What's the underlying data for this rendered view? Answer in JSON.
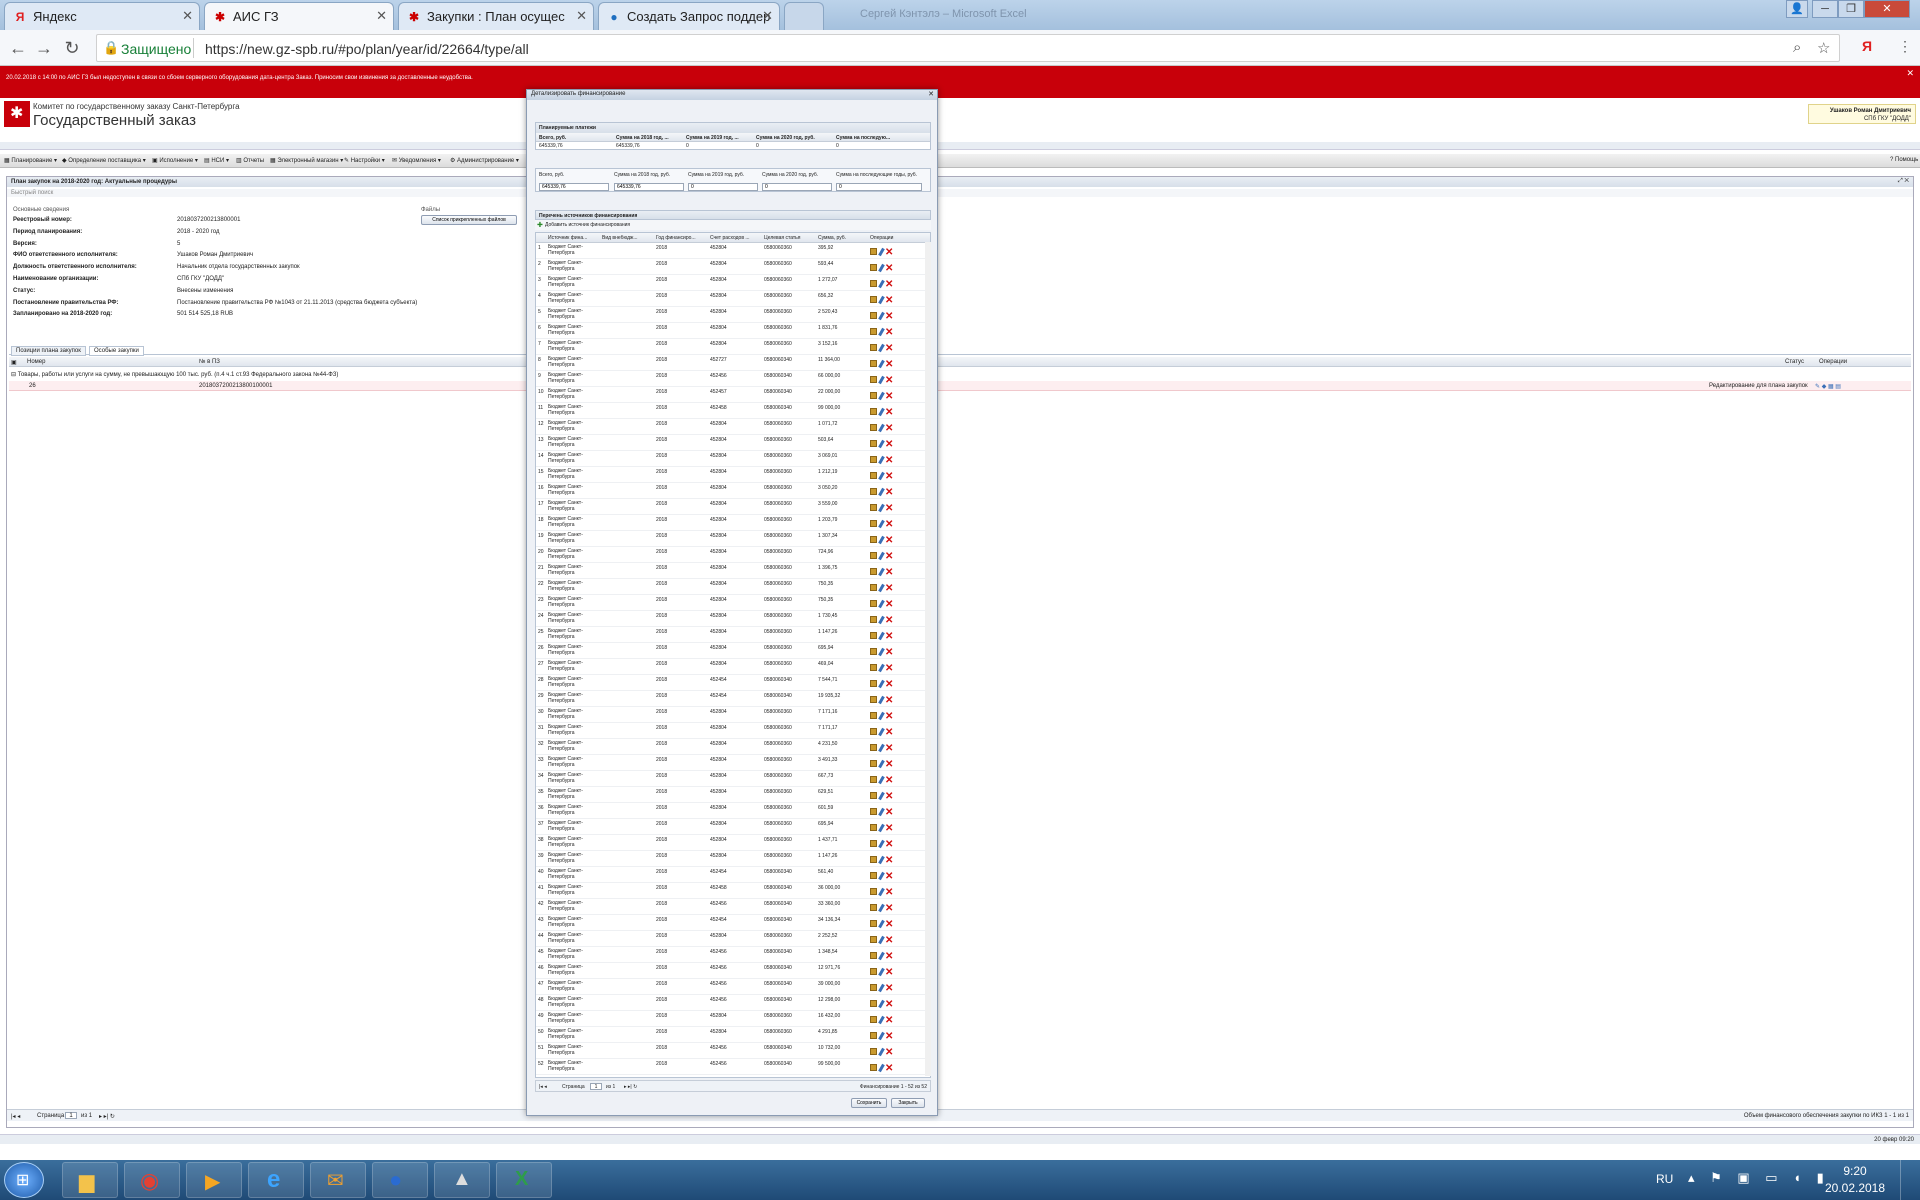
{
  "browser": {
    "tabs": [
      {
        "title": "Яндекс",
        "icon": "yandex-icon"
      },
      {
        "title": "АИС ГЗ",
        "icon": "gz-icon"
      },
      {
        "title": "Закупки : План осущес",
        "icon": "gz-icon"
      },
      {
        "title": "Создать Запрос поддер",
        "icon": "globe-icon"
      },
      {
        "title": "",
        "icon": "blank-icon"
      }
    ],
    "secure_label": "Защищено",
    "url": "https://new.gz-spb.ru/#po/plan/year/id/22664/type/all",
    "window_title": "Сергей Кэнтэлэ – Microsoft Excel"
  },
  "banner": {
    "text": "20.02.2018 с 14:00 по АИС ГЗ был недоступен в связи со сбоем серверного оборудования дата-центра Заказ. Приносим свои извинения за доставленные неудобства."
  },
  "app": {
    "org_line": "Комитет по государственному заказу Санкт-Петербурга",
    "brand": "Государственный заказ",
    "user_name": "Ушаков Роман Дмитриевич",
    "user_org": "СПб ГКУ \"ДОДД\"",
    "menu": [
      "Планирование",
      "Определение поставщика",
      "Исполнение",
      "НСИ",
      "Отчеты",
      "Электронный магазин",
      "Настройки",
      "Уведомления",
      "Администрирование"
    ],
    "help": "Помощь"
  },
  "plan": {
    "title": "План закупок на 2018-2020 год: Актуальные процедуры",
    "quick_search": "Быстрый поиск",
    "section": "Основные сведения",
    "files_label": "Файлы",
    "files_button": "Список прикрепленных файлов",
    "fields": [
      {
        "label": "Реестровый номер:",
        "value": "2018037200213800001"
      },
      {
        "label": "Период планирования:",
        "value": "2018 - 2020 год"
      },
      {
        "label": "Версия:",
        "value": "5"
      },
      {
        "label": "ФИО ответственного исполнителя:",
        "value": "Ушаков Роман Дмитриевич"
      },
      {
        "label": "Должность ответственного исполнителя:",
        "value": "Начальник отдела государственных закупок"
      },
      {
        "label": "Наименование организации:",
        "value": "СПб ГКУ \"ДОДД\""
      },
      {
        "label": "Статус:",
        "value": "Внесены изменения"
      },
      {
        "label": "Постановление правительства РФ:",
        "value": "Постановление правительства РФ №1043 от 21.11.2013 (средства бюджета субъекта)"
      },
      {
        "label": "Запланировано на 2018-2020 год:",
        "value": "501 514 525,18 RUB"
      }
    ],
    "tabs": [
      "Позиции плана закупок",
      "Особые закупки"
    ],
    "grid_headers": [
      "Номер",
      "№ в ПЗ",
      "Статус",
      "Операции"
    ],
    "group_row": "Товары, работы или услуги на сумму, не превышающую 100 тыс. руб. (п.4 ч.1 ст.93 Федерального закона №44-ФЗ)",
    "row": {
      "num": "26",
      "pz": "2018037200213800100001",
      "status": "Редактирование для плана закупок"
    },
    "pager": {
      "page_label": "Страница",
      "page": "1",
      "of": "из 1"
    },
    "footer_text": "Объем финансового обеспечения закупки по ИКЗ 1 - 1 из 1"
  },
  "modal": {
    "title": "Детализировать финансирование",
    "planned_section": "Планируемые платежи",
    "planned_headers": [
      "Всего, руб.",
      "Сумма на 2018 год, ...",
      "Сумма на 2019 год, ...",
      "Сумма на 2020 год, руб.",
      "Сумма на последую..."
    ],
    "planned_values": [
      "645339,76",
      "645339,76",
      "0",
      "0",
      "0"
    ],
    "edit_headers": [
      "Всего, руб.",
      "Сумма на 2018 год, руб.",
      "Сумма на 2019 год, руб.",
      "Сумма на 2020 год, руб.",
      "Сумма на последующие годы, руб."
    ],
    "edit_values": [
      "645339,76",
      "645339,76",
      "0",
      "0",
      "0"
    ],
    "sources_section": "Перечень источников финансирования",
    "add_button": "Добавить источник финансирования",
    "grid_headers": [
      "Источник фина...",
      "Вид внебюдж...",
      "Год финансиро...",
      "Счет расходов ...",
      "Целевая статья",
      "Сумма, руб.",
      "Операции"
    ],
    "source_name": "Бюджет Санкт-Петербурга",
    "year": "2018",
    "rows": [
      {
        "n": "1",
        "acc": "452804",
        "cs": "0580060360",
        "sum": "395,92"
      },
      {
        "n": "2",
        "acc": "452804",
        "cs": "0580060360",
        "sum": "593,44"
      },
      {
        "n": "3",
        "acc": "452804",
        "cs": "0580060360",
        "sum": "1 272,07"
      },
      {
        "n": "4",
        "acc": "452804",
        "cs": "0580060360",
        "sum": "656,32"
      },
      {
        "n": "5",
        "acc": "452804",
        "cs": "0580060360",
        "sum": "2 520,43"
      },
      {
        "n": "6",
        "acc": "452804",
        "cs": "0580060360",
        "sum": "1 831,76"
      },
      {
        "n": "7",
        "acc": "452804",
        "cs": "0580060360",
        "sum": "3 152,16"
      },
      {
        "n": "8",
        "acc": "452727",
        "cs": "0580060340",
        "sum": "11 364,00"
      },
      {
        "n": "9",
        "acc": "452456",
        "cs": "0580060340",
        "sum": "66 000,00"
      },
      {
        "n": "10",
        "acc": "452457",
        "cs": "0580060340",
        "sum": "22 000,00"
      },
      {
        "n": "11",
        "acc": "452458",
        "cs": "0580060340",
        "sum": "99 000,00"
      },
      {
        "n": "12",
        "acc": "452804",
        "cs": "0580060360",
        "sum": "1 071,72"
      },
      {
        "n": "13",
        "acc": "452804",
        "cs": "0580060360",
        "sum": "503,64"
      },
      {
        "n": "14",
        "acc": "452804",
        "cs": "0580060360",
        "sum": "3 069,01"
      },
      {
        "n": "15",
        "acc": "452804",
        "cs": "0580060360",
        "sum": "1 212,19"
      },
      {
        "n": "16",
        "acc": "452804",
        "cs": "0580060360",
        "sum": "3 050,20"
      },
      {
        "n": "17",
        "acc": "452804",
        "cs": "0580060360",
        "sum": "3 559,00"
      },
      {
        "n": "18",
        "acc": "452804",
        "cs": "0580060360",
        "sum": "1 203,79"
      },
      {
        "n": "19",
        "acc": "452804",
        "cs": "0580060360",
        "sum": "1 307,34"
      },
      {
        "n": "20",
        "acc": "452804",
        "cs": "0580060360",
        "sum": "724,96"
      },
      {
        "n": "21",
        "acc": "452804",
        "cs": "0580060360",
        "sum": "1 396,75"
      },
      {
        "n": "22",
        "acc": "452804",
        "cs": "0580060360",
        "sum": "750,35"
      },
      {
        "n": "23",
        "acc": "452804",
        "cs": "0580060360",
        "sum": "750,35"
      },
      {
        "n": "24",
        "acc": "452804",
        "cs": "0580060360",
        "sum": "1 730,45"
      },
      {
        "n": "25",
        "acc": "452804",
        "cs": "0580060360",
        "sum": "1 147,26"
      },
      {
        "n": "26",
        "acc": "452804",
        "cs": "0580060360",
        "sum": "695,94"
      },
      {
        "n": "27",
        "acc": "452804",
        "cs": "0580060360",
        "sum": "469,04"
      },
      {
        "n": "28",
        "acc": "452454",
        "cs": "0580060340",
        "sum": "7 544,71"
      },
      {
        "n": "29",
        "acc": "452454",
        "cs": "0580060340",
        "sum": "19 935,32"
      },
      {
        "n": "30",
        "acc": "452804",
        "cs": "0580060360",
        "sum": "7 171,16"
      },
      {
        "n": "31",
        "acc": "452804",
        "cs": "0580060360",
        "sum": "7 171,17"
      },
      {
        "n": "32",
        "acc": "452804",
        "cs": "0580060360",
        "sum": "4 231,50"
      },
      {
        "n": "33",
        "acc": "452804",
        "cs": "0580060360",
        "sum": "3 491,33"
      },
      {
        "n": "34",
        "acc": "452804",
        "cs": "0580060360",
        "sum": "667,73"
      },
      {
        "n": "35",
        "acc": "452804",
        "cs": "0580060360",
        "sum": "629,51"
      },
      {
        "n": "36",
        "acc": "452804",
        "cs": "0580060360",
        "sum": "601,59"
      },
      {
        "n": "37",
        "acc": "452804",
        "cs": "0580060360",
        "sum": "695,94"
      },
      {
        "n": "38",
        "acc": "452804",
        "cs": "0580060360",
        "sum": "1 437,71"
      },
      {
        "n": "39",
        "acc": "452804",
        "cs": "0580060360",
        "sum": "1 147,26"
      },
      {
        "n": "40",
        "acc": "452454",
        "cs": "0580060340",
        "sum": "561,40"
      },
      {
        "n": "41",
        "acc": "452458",
        "cs": "0580060340",
        "sum": "36 000,00"
      },
      {
        "n": "42",
        "acc": "452456",
        "cs": "0580060340",
        "sum": "33 360,00"
      },
      {
        "n": "43",
        "acc": "452454",
        "cs": "0580060340",
        "sum": "34 136,34"
      },
      {
        "n": "44",
        "acc": "452804",
        "cs": "0580060360",
        "sum": "2 252,52"
      },
      {
        "n": "45",
        "acc": "452456",
        "cs": "0580060340",
        "sum": "1 348,54"
      },
      {
        "n": "46",
        "acc": "452456",
        "cs": "0580060340",
        "sum": "12 971,76"
      },
      {
        "n": "47",
        "acc": "452456",
        "cs": "0580060340",
        "sum": "39 000,00"
      },
      {
        "n": "48",
        "acc": "452456",
        "cs": "0580060340",
        "sum": "12 298,00"
      },
      {
        "n": "49",
        "acc": "452804",
        "cs": "0580060360",
        "sum": "16 432,00"
      },
      {
        "n": "50",
        "acc": "452804",
        "cs": "0580060360",
        "sum": "4 291,85"
      },
      {
        "n": "51",
        "acc": "452456",
        "cs": "0580060340",
        "sum": "10 732,00"
      },
      {
        "n": "52",
        "acc": "452456",
        "cs": "0580060340",
        "sum": "99 500,00"
      }
    ],
    "pager": {
      "page_label": "Страница",
      "page": "1",
      "of": "из 1",
      "summary": "Финансирование 1 - 52 из 52"
    },
    "save": "Сохранить",
    "close": "Закрыть"
  },
  "taskbar": {
    "lang": "RU",
    "time": "9:20",
    "date": "20.02.2018",
    "status_right": "20 февр 09:20",
    "apps": [
      "files-icon",
      "chrome-icon",
      "media-icon",
      "ie-icon",
      "outlook-icon",
      "browser2-icon",
      "app-icon",
      "excel-icon"
    ]
  }
}
